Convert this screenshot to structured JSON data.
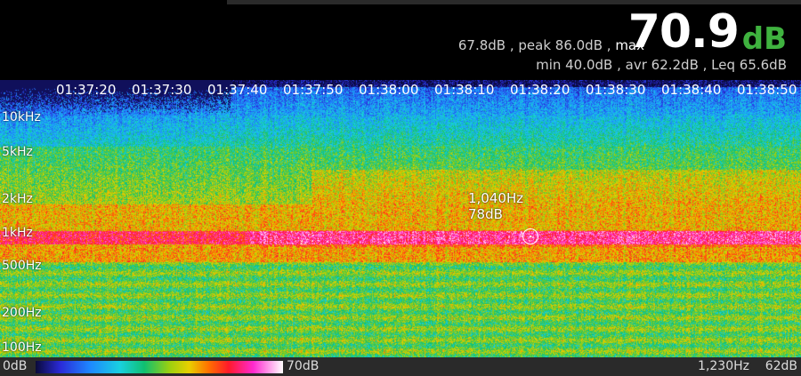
{
  "header": {
    "level_value": "70.9",
    "level_unit": "dB",
    "stats_line1_prefix": "67.8dB , peak 86.0dB ,",
    "stats_line1_max": "max",
    "stats_line2": "min 40.0dB , avr 62.2dB , Leq 65.6dB"
  },
  "time_axis": [
    "01:37:20",
    "01:37:30",
    "01:37:40",
    "01:37:50",
    "01:38:00",
    "01:38:10",
    "01:38:20",
    "01:38:30",
    "01:38:40",
    "01:38:50"
  ],
  "freq_axis": [
    "10kHz",
    "5kHz",
    "2kHz",
    "1kHz",
    "500Hz",
    "200Hz",
    "100Hz"
  ],
  "cursor": {
    "freq": "1,040Hz",
    "db": "78dB"
  },
  "color_scale": {
    "min_label": "0dB",
    "max_label": "70dB"
  },
  "footer": {
    "cursor_freq": "1,230Hz",
    "cursor_db": "62dB"
  },
  "colors": {
    "unit_green": "#3fb23f",
    "background": "#000000",
    "footer_bg": "#2a2a2a"
  }
}
